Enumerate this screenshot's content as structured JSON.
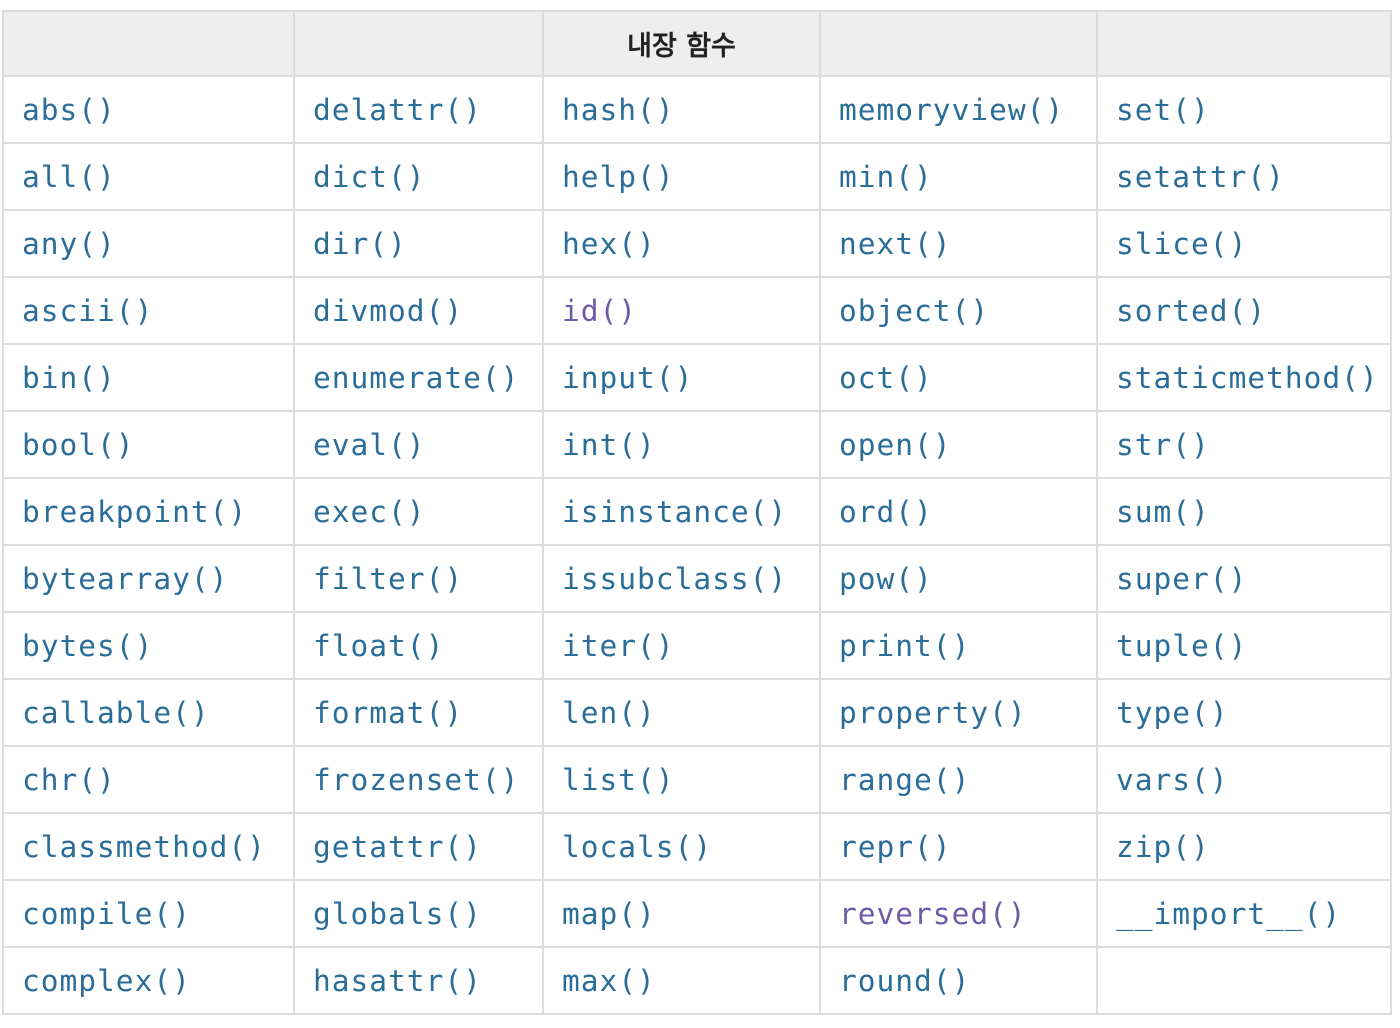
{
  "table": {
    "title": "내장 함수",
    "colors": {
      "link": "#2b6d99",
      "visited_link": "#6f5aa8",
      "header_bg": "#eeeeee",
      "border": "#dcdcdc"
    },
    "rows": [
      [
        "abs()",
        "delattr()",
        "hash()",
        "memoryview()",
        "set()"
      ],
      [
        "all()",
        "dict()",
        "help()",
        "min()",
        "setattr()"
      ],
      [
        "any()",
        "dir()",
        "hex()",
        "next()",
        "slice()"
      ],
      [
        "ascii()",
        "divmod()",
        "id()",
        "object()",
        "sorted()"
      ],
      [
        "bin()",
        "enumerate()",
        "input()",
        "oct()",
        "staticmethod()"
      ],
      [
        "bool()",
        "eval()",
        "int()",
        "open()",
        "str()"
      ],
      [
        "breakpoint()",
        "exec()",
        "isinstance()",
        "ord()",
        "sum()"
      ],
      [
        "bytearray()",
        "filter()",
        "issubclass()",
        "pow()",
        "super()"
      ],
      [
        "bytes()",
        "float()",
        "iter()",
        "print()",
        "tuple()"
      ],
      [
        "callable()",
        "format()",
        "len()",
        "property()",
        "type()"
      ],
      [
        "chr()",
        "frozenset()",
        "list()",
        "range()",
        "vars()"
      ],
      [
        "classmethod()",
        "getattr()",
        "locals()",
        "repr()",
        "zip()"
      ],
      [
        "compile()",
        "globals()",
        "map()",
        "reversed()",
        "__import__()"
      ],
      [
        "complex()",
        "hasattr()",
        "max()",
        "round()",
        ""
      ]
    ],
    "visited": [
      "id()",
      "reversed()"
    ]
  }
}
